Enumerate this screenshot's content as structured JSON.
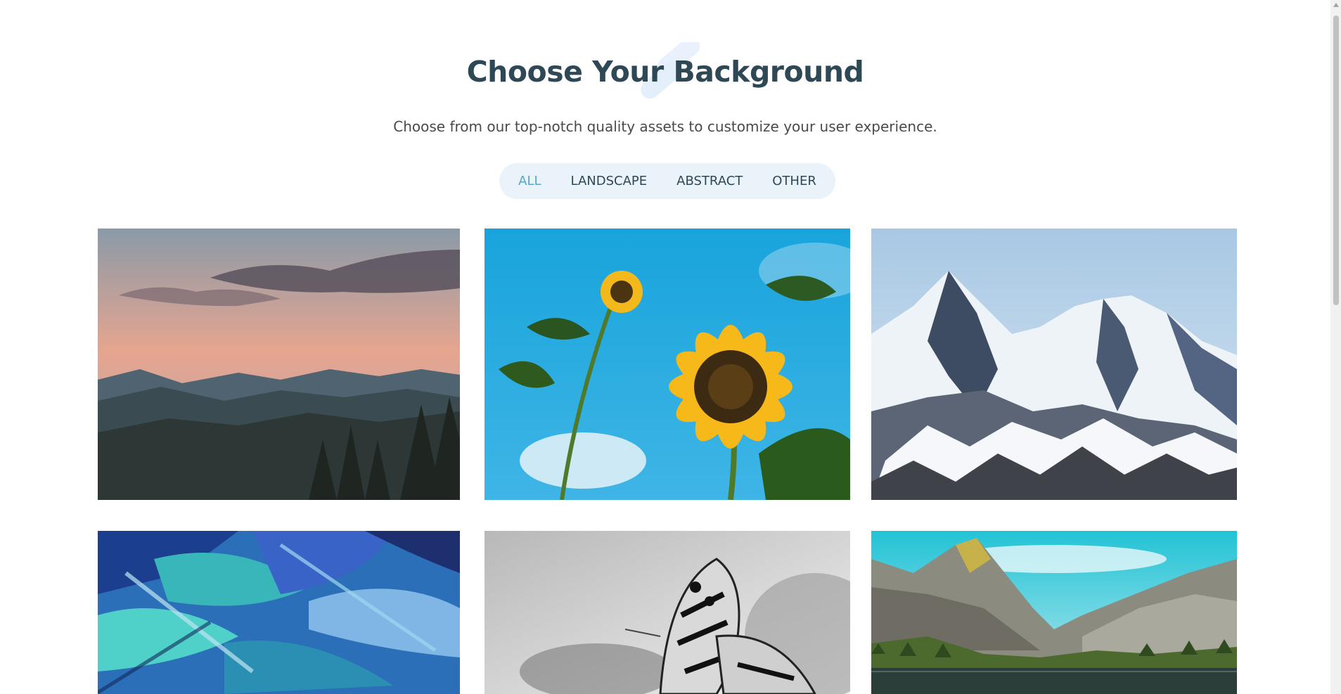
{
  "header": {
    "title": "Choose Your Background",
    "subtitle": "Choose from our top-notch quality assets to customize your user experience."
  },
  "filters": [
    {
      "label": "ALL",
      "active": true
    },
    {
      "label": "LANDSCAPE",
      "active": false
    },
    {
      "label": "ABSTRACT",
      "active": false
    },
    {
      "label": "OTHER",
      "active": false
    }
  ],
  "colors": {
    "title": "#2e4856",
    "accent": "#5aa6c8",
    "filter_bg": "#eaf3fa"
  },
  "gallery": [
    {
      "image": "sunset-mountains-image"
    },
    {
      "image": "sunflower-image"
    },
    {
      "image": "snowy-peaks-image"
    },
    {
      "image": "abstract-blue-paint-image"
    },
    {
      "image": "butterfly-bw-image"
    },
    {
      "image": "mountain-lake-image"
    }
  ]
}
